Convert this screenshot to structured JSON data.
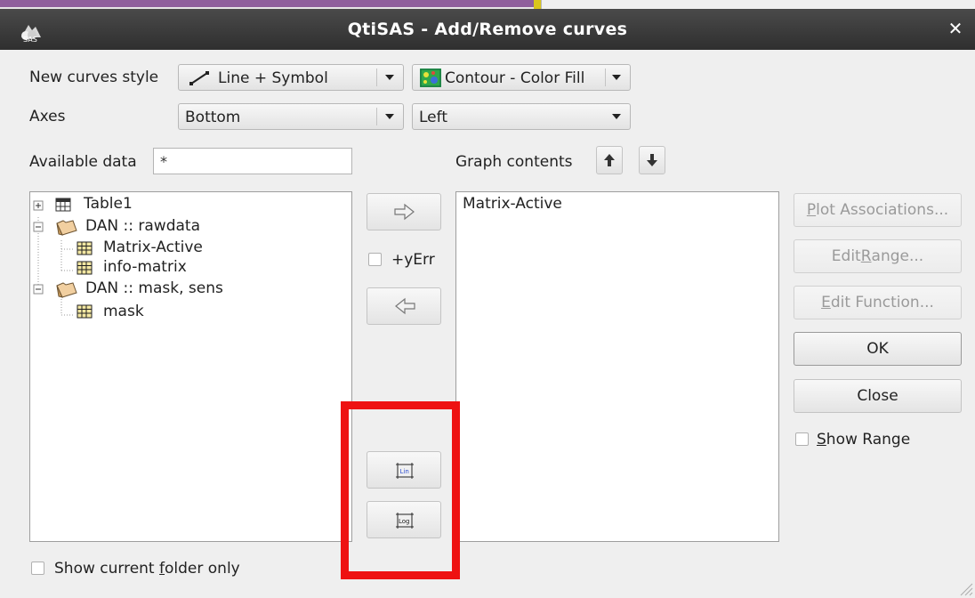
{
  "window": {
    "title": "QtiSAS - Add/Remove curves",
    "app_icon": "qtisas-logo-icon",
    "close_icon": "close-icon",
    "close_glyph": "✕"
  },
  "style_row": {
    "label": "New curves style",
    "curve_style": {
      "value": "Line + Symbol",
      "icon": "line-symbol-icon"
    },
    "matrix_style": {
      "value": "Contour - Color Fill",
      "icon": "contour-color-fill-icon"
    }
  },
  "axes_row": {
    "label": "Axes",
    "x_axis": {
      "value": "Bottom"
    },
    "y_axis": {
      "value": "Left"
    }
  },
  "available": {
    "label": "Available data",
    "filter_value": "*",
    "tree": [
      {
        "label": "Table1",
        "icon": "table-icon",
        "expander": "plus"
      },
      {
        "label": "DAN :: rawdata",
        "icon": "folder-open-icon",
        "expander": "minus"
      },
      {
        "label": "Matrix-Active",
        "icon": "matrix-icon"
      },
      {
        "label": "info-matrix",
        "icon": "matrix-icon"
      },
      {
        "label": "DAN :: mask, sens",
        "icon": "folder-open-icon",
        "expander": "minus"
      },
      {
        "label": "mask",
        "icon": "matrix-icon"
      }
    ]
  },
  "graph_contents": {
    "label": "Graph contents",
    "up_icon": "arrow-up-icon",
    "down_icon": "arrow-down-icon",
    "items": [
      "Matrix-Active"
    ]
  },
  "middle": {
    "add_icon": "arrow-right-icon",
    "remove_icon": "arrow-left-icon",
    "y_err_label": "+yErr",
    "y_err_checked": false,
    "lin_icon": "lin-scale-icon",
    "lin_text": "Lin",
    "log_icon": "log-scale-icon",
    "log_text": "Log"
  },
  "buttons": {
    "plot_associations": {
      "pre": "",
      "mnemonic": "P",
      "post": "lot Associations..."
    },
    "edit_range": {
      "pre": "Edit ",
      "mnemonic": "R",
      "post": "ange..."
    },
    "edit_function": {
      "pre": "",
      "mnemonic": "E",
      "post": "dit Function..."
    },
    "ok": "OK",
    "close": "Close",
    "show_range": {
      "pre": "",
      "mnemonic": "S",
      "post": "how Range",
      "checked": false
    }
  },
  "bottom": {
    "show_current_folder": {
      "pre": "Show current ",
      "mnemonic": "f",
      "post": "older only",
      "checked": false
    }
  },
  "annotation": {
    "color": "#ee1212"
  },
  "colors": {
    "titlebar": "#3a3a3a",
    "dialog_bg": "#efefef",
    "disabled_text": "#9a9a9a"
  }
}
